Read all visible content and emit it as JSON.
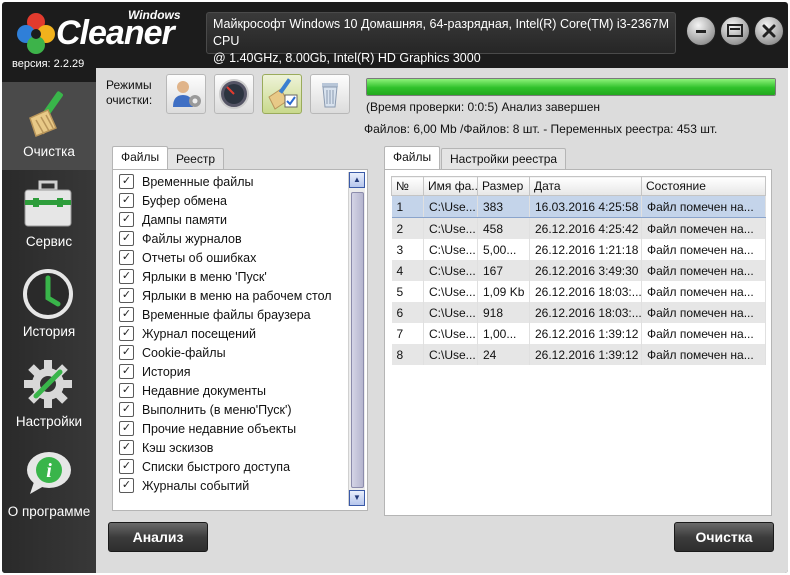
{
  "header": {
    "logo_sub": "Windows",
    "logo_brand": "Cleaner",
    "version": "версия: 2.2.29",
    "sysinfo_line1": "Майкрософт Windows 10 Домашняя, 64-разрядная, Intel(R) Core(TM) i3-2367M CPU",
    "sysinfo_line2": "@ 1.40GHz, 8.00Gb, Intel(R) HD Graphics 3000"
  },
  "window_controls": [
    "minimize-icon",
    "tray-icon",
    "close-icon"
  ],
  "sidebar": {
    "items": [
      {
        "label": "Очистка",
        "icon": "broom-icon"
      },
      {
        "label": "Сервис",
        "icon": "toolbox-icon"
      },
      {
        "label": "История",
        "icon": "clock-icon"
      },
      {
        "label": "Настройки",
        "icon": "gear-icon"
      },
      {
        "label": "О программе",
        "icon": "info-icon"
      }
    ]
  },
  "modes": {
    "label_line1": "Режимы",
    "label_line2": "очистки:",
    "buttons": [
      "user-settings-icon",
      "gauge-icon",
      "broom-check-icon",
      "trash-bin-icon"
    ],
    "active_index": 2
  },
  "scan": {
    "progress_percent": 100,
    "status": "(Время проверки: 0:0:5) Анализ завершен",
    "totals": "Файлов: 6,00 Mb /Файлов: 8 шт. - Переменных реестра: 453 шт."
  },
  "left_tabs": [
    "Файлы",
    "Реестр"
  ],
  "file_items": [
    "Временные файлы",
    "Буфер обмена",
    "Дампы памяти",
    "Файлы журналов",
    "Отчеты об ошибках",
    "Ярлыки в меню 'Пуск'",
    "Ярлыки в меню на рабочем стол",
    "Временные файлы браузера",
    "Журнал посещений",
    "Cookie-файлы",
    "История",
    "Недавние документы",
    "Выполнить (в меню'Пуск')",
    "Прочие недавние объекты",
    "Кэш эскизов",
    "Списки быстрого доступа",
    "Журналы событий"
  ],
  "right_tabs": [
    "Файлы",
    "Настройки реестра"
  ],
  "table": {
    "columns": [
      "№",
      "Имя фа...",
      "Размер",
      "Дата",
      "Состояние"
    ],
    "rows": [
      [
        "1",
        "C:\\Use...",
        "383",
        "16.03.2016 4:25:58",
        "Файл помечен на..."
      ],
      [
        "2",
        "C:\\Use...",
        "458",
        "26.12.2016 4:25:42",
        "Файл помечен на..."
      ],
      [
        "3",
        "C:\\Use...",
        "5,00...",
        "26.12.2016 1:21:18",
        "Файл помечен на..."
      ],
      [
        "4",
        "C:\\Use...",
        "167",
        "26.12.2016 3:49:30",
        "Файл помечен на..."
      ],
      [
        "5",
        "C:\\Use...",
        "1,09 Kb",
        "26.12.2016 18:03:...",
        "Файл помечен на..."
      ],
      [
        "6",
        "C:\\Use...",
        "918",
        "26.12.2016 18:03:...",
        "Файл помечен на..."
      ],
      [
        "7",
        "C:\\Use...",
        "1,00...",
        "26.12.2016 1:39:12",
        "Файл помечен на..."
      ],
      [
        "8",
        "C:\\Use...",
        "24",
        "26.12.2016 1:39:12",
        "Файл помечен на..."
      ]
    ],
    "selected_row": 0
  },
  "buttons": {
    "analyze": "Анализ",
    "clean": "Очистка"
  }
}
